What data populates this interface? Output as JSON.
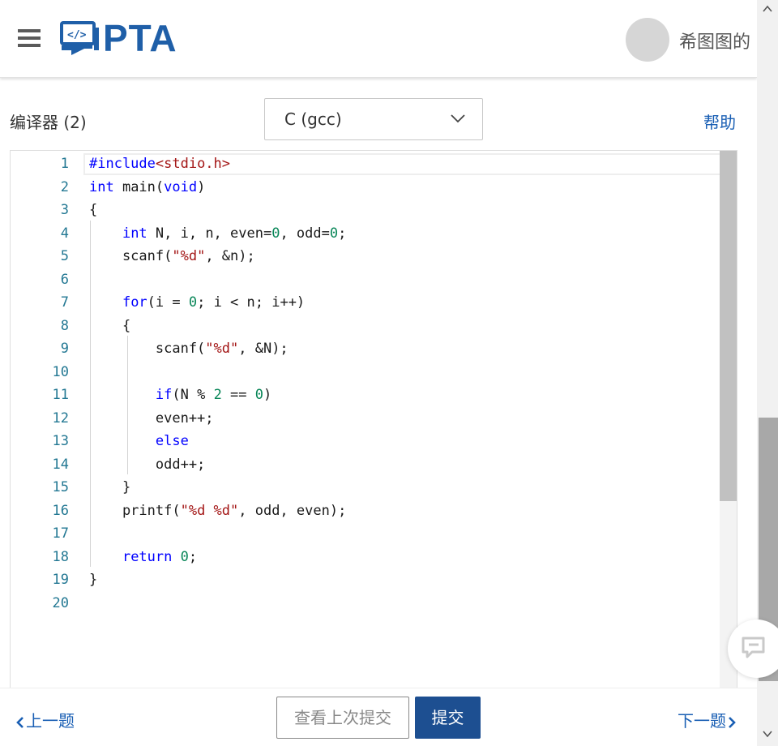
{
  "header": {
    "logo_text": "PTA",
    "username": "希图图的"
  },
  "toolbar": {
    "compiler_label": "编译器 (2)",
    "language_selected": "C (gcc)",
    "help_label": "帮助"
  },
  "editor": {
    "line_numbers": [
      "1",
      "2",
      "3",
      "4",
      "5",
      "6",
      "7",
      "8",
      "9",
      "10",
      "11",
      "12",
      "13",
      "14",
      "15",
      "16",
      "17",
      "18",
      "19",
      "20"
    ],
    "lines": [
      "#include<stdio.h>",
      "int main(void)",
      "{",
      "    int N, i, n, even=0, odd=0;",
      "    scanf(\"%d\", &n);",
      "",
      "    for(i = 0; i < n; i++)",
      "    {",
      "        scanf(\"%d\", &N);",
      "",
      "        if(N % 2 == 0)",
      "        even++;",
      "        else",
      "        odd++;",
      "    }",
      "    printf(\"%d %d\", odd, even);",
      "",
      "    return 0;",
      "}",
      ""
    ]
  },
  "footer": {
    "prev_label": "上一题",
    "view_last_label": "查看上次提交",
    "submit_label": "提交",
    "next_label": "下一题"
  },
  "colors": {
    "brand": "#1f5fa8",
    "submit": "#1d4f91",
    "link": "#1a5fb4",
    "keyword": "#0000ff",
    "string": "#a31515",
    "number": "#098658",
    "line_number": "#237893"
  },
  "icons": {
    "menu": "hamburger-icon",
    "logo": "code-monitor-icon",
    "dropdown": "chevron-down-icon",
    "prev": "chevron-left-icon",
    "next": "chevron-right-icon",
    "feedback": "feedback-icon"
  }
}
